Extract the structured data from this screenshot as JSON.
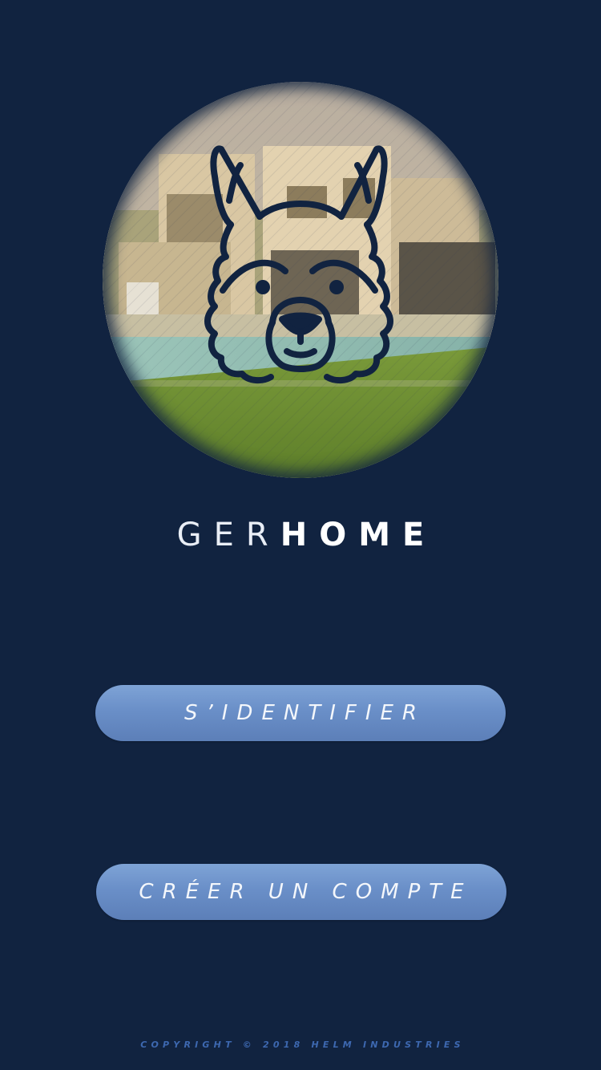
{
  "app": {
    "brand_light": "GER",
    "brand_bold": "HOME"
  },
  "hero": {
    "icon": "wolf-mascot-icon",
    "photo": "house-with-pool-photo"
  },
  "actions": {
    "login_label": "S’IDENTIFIER",
    "register_label": "CRÉER UN COMPTE"
  },
  "footer": {
    "copyright": "COPYRIGHT © 2018 HELM INDUSTRIES"
  },
  "colors": {
    "background": "#112340",
    "button": "#6a8fc8",
    "copyright": "#3d68b0",
    "icon_stroke": "#112340"
  }
}
